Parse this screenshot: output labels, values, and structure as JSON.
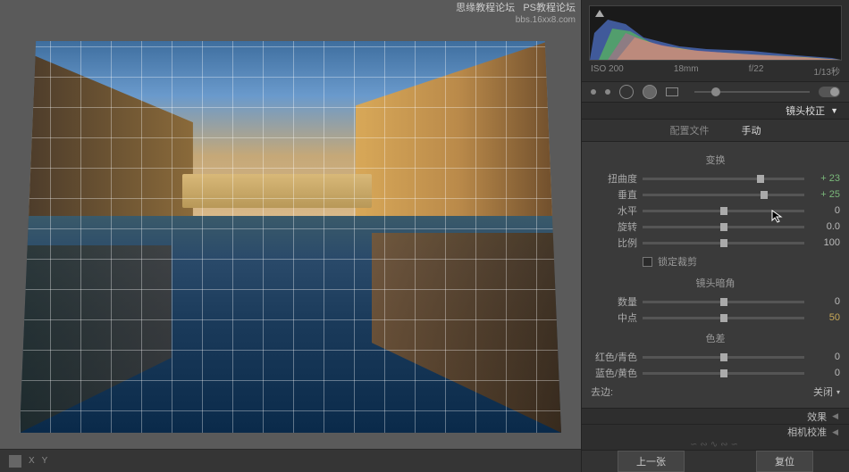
{
  "watermark": {
    "line1": "思缘教程论坛",
    "line2": "PS教程论坛",
    "line3": "bbs.16xx8.com"
  },
  "histogram": {
    "iso": "ISO 200",
    "focal": "18mm",
    "aperture": "f/22",
    "shutter": "1/13秒"
  },
  "panels": {
    "lensCorrection": "镜头校正",
    "effects": "效果",
    "cameraCalibration": "相机校准"
  },
  "tabs": {
    "profile": "配置文件",
    "manual": "手动"
  },
  "sections": {
    "transform": "变换",
    "vignette": "镜头暗角",
    "ca": "色差"
  },
  "sliders": {
    "distortion": {
      "label": "扭曲度",
      "value": "+ 23",
      "pos": 73
    },
    "vertical": {
      "label": "垂直",
      "value": "+ 25",
      "pos": 75
    },
    "horizontal": {
      "label": "水平",
      "value": "0",
      "pos": 50
    },
    "rotate": {
      "label": "旋转",
      "value": "0.0",
      "pos": 50
    },
    "scale": {
      "label": "比例",
      "value": "100",
      "pos": 50
    },
    "amount": {
      "label": "数量",
      "value": "0",
      "pos": 50
    },
    "midpoint": {
      "label": "中点",
      "value": "50",
      "pos": 50
    },
    "redcyan": {
      "label": "红色/青色",
      "value": "0",
      "pos": 50
    },
    "blueyellow": {
      "label": "蓝色/黄色",
      "value": "0",
      "pos": 50
    }
  },
  "constrainCrop": "锁定裁剪",
  "defringe": {
    "label": "去边:",
    "value": "关闭"
  },
  "nav": {
    "prev": "上一张",
    "reset": "复位"
  },
  "toolbar": {
    "x": "X",
    "y": "Y"
  }
}
